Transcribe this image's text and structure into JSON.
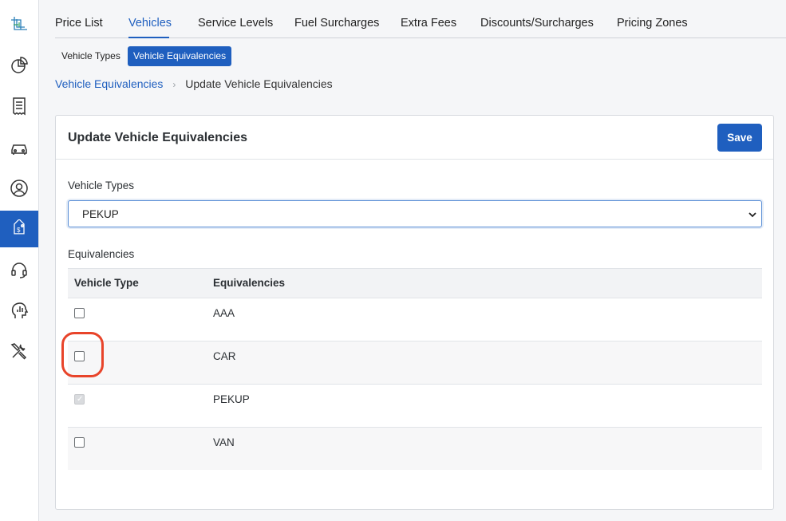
{
  "sidebar": {
    "items": [
      {
        "icon": "logo-icon"
      },
      {
        "icon": "pie-chart-icon"
      },
      {
        "icon": "receipt-icon"
      },
      {
        "icon": "car-icon"
      },
      {
        "icon": "user-circle-icon"
      },
      {
        "icon": "price-tag-icon",
        "active": true
      },
      {
        "icon": "headset-icon"
      },
      {
        "icon": "head-analytics-icon"
      },
      {
        "icon": "tools-icon"
      }
    ]
  },
  "tabs": [
    "Price List",
    "Vehicles",
    "Service Levels",
    "Fuel Surcharges",
    "Extra Fees",
    "Discounts/Surcharges",
    "Pricing Zones"
  ],
  "active_tab": "Vehicles",
  "subtabs": [
    "Vehicle Types",
    "Vehicle Equivalencies"
  ],
  "active_subtab": "Vehicle Equivalencies",
  "breadcrumb": {
    "parent": "Vehicle Equivalencies",
    "current": "Update Vehicle Equivalencies"
  },
  "card": {
    "title": "Update Vehicle Equivalencies",
    "save_label": "Save"
  },
  "form": {
    "vehicle_types_label": "Vehicle Types",
    "vehicle_types_value": "PEKUP",
    "equivalencies_label": "Equivalencies"
  },
  "table": {
    "headers": [
      "Vehicle Type",
      "Equivalencies"
    ],
    "rows": [
      {
        "name": "AAA",
        "checked": false,
        "disabled": false
      },
      {
        "name": "CAR",
        "checked": false,
        "disabled": false
      },
      {
        "name": "PEKUP",
        "checked": true,
        "disabled": true
      },
      {
        "name": "VAN",
        "checked": false,
        "disabled": false
      }
    ]
  },
  "colors": {
    "accent": "#1f5fbf",
    "highlight": "#e8442a"
  }
}
